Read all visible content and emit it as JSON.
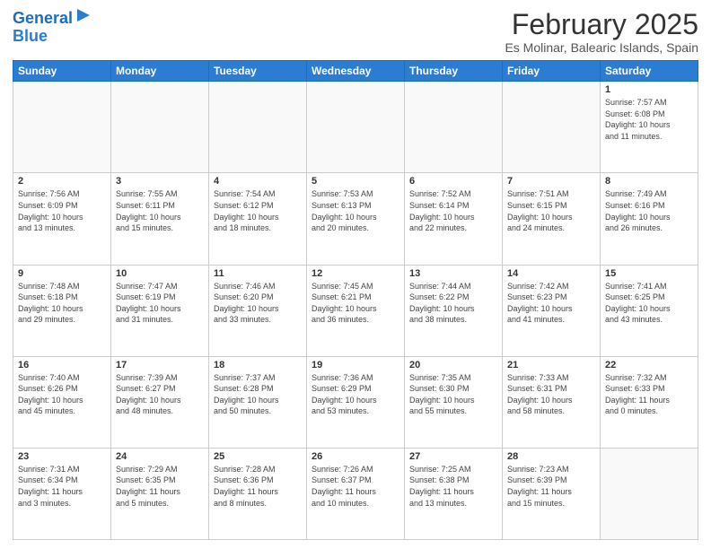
{
  "logo": {
    "line1": "General",
    "line2": "Blue"
  },
  "header": {
    "month": "February 2025",
    "location": "Es Molinar, Balearic Islands, Spain"
  },
  "weekdays": [
    "Sunday",
    "Monday",
    "Tuesday",
    "Wednesday",
    "Thursday",
    "Friday",
    "Saturday"
  ],
  "weeks": [
    [
      {
        "day": "",
        "info": ""
      },
      {
        "day": "",
        "info": ""
      },
      {
        "day": "",
        "info": ""
      },
      {
        "day": "",
        "info": ""
      },
      {
        "day": "",
        "info": ""
      },
      {
        "day": "",
        "info": ""
      },
      {
        "day": "1",
        "info": "Sunrise: 7:57 AM\nSunset: 6:08 PM\nDaylight: 10 hours\nand 11 minutes."
      }
    ],
    [
      {
        "day": "2",
        "info": "Sunrise: 7:56 AM\nSunset: 6:09 PM\nDaylight: 10 hours\nand 13 minutes."
      },
      {
        "day": "3",
        "info": "Sunrise: 7:55 AM\nSunset: 6:11 PM\nDaylight: 10 hours\nand 15 minutes."
      },
      {
        "day": "4",
        "info": "Sunrise: 7:54 AM\nSunset: 6:12 PM\nDaylight: 10 hours\nand 18 minutes."
      },
      {
        "day": "5",
        "info": "Sunrise: 7:53 AM\nSunset: 6:13 PM\nDaylight: 10 hours\nand 20 minutes."
      },
      {
        "day": "6",
        "info": "Sunrise: 7:52 AM\nSunset: 6:14 PM\nDaylight: 10 hours\nand 22 minutes."
      },
      {
        "day": "7",
        "info": "Sunrise: 7:51 AM\nSunset: 6:15 PM\nDaylight: 10 hours\nand 24 minutes."
      },
      {
        "day": "8",
        "info": "Sunrise: 7:49 AM\nSunset: 6:16 PM\nDaylight: 10 hours\nand 26 minutes."
      }
    ],
    [
      {
        "day": "9",
        "info": "Sunrise: 7:48 AM\nSunset: 6:18 PM\nDaylight: 10 hours\nand 29 minutes."
      },
      {
        "day": "10",
        "info": "Sunrise: 7:47 AM\nSunset: 6:19 PM\nDaylight: 10 hours\nand 31 minutes."
      },
      {
        "day": "11",
        "info": "Sunrise: 7:46 AM\nSunset: 6:20 PM\nDaylight: 10 hours\nand 33 minutes."
      },
      {
        "day": "12",
        "info": "Sunrise: 7:45 AM\nSunset: 6:21 PM\nDaylight: 10 hours\nand 36 minutes."
      },
      {
        "day": "13",
        "info": "Sunrise: 7:44 AM\nSunset: 6:22 PM\nDaylight: 10 hours\nand 38 minutes."
      },
      {
        "day": "14",
        "info": "Sunrise: 7:42 AM\nSunset: 6:23 PM\nDaylight: 10 hours\nand 41 minutes."
      },
      {
        "day": "15",
        "info": "Sunrise: 7:41 AM\nSunset: 6:25 PM\nDaylight: 10 hours\nand 43 minutes."
      }
    ],
    [
      {
        "day": "16",
        "info": "Sunrise: 7:40 AM\nSunset: 6:26 PM\nDaylight: 10 hours\nand 45 minutes."
      },
      {
        "day": "17",
        "info": "Sunrise: 7:39 AM\nSunset: 6:27 PM\nDaylight: 10 hours\nand 48 minutes."
      },
      {
        "day": "18",
        "info": "Sunrise: 7:37 AM\nSunset: 6:28 PM\nDaylight: 10 hours\nand 50 minutes."
      },
      {
        "day": "19",
        "info": "Sunrise: 7:36 AM\nSunset: 6:29 PM\nDaylight: 10 hours\nand 53 minutes."
      },
      {
        "day": "20",
        "info": "Sunrise: 7:35 AM\nSunset: 6:30 PM\nDaylight: 10 hours\nand 55 minutes."
      },
      {
        "day": "21",
        "info": "Sunrise: 7:33 AM\nSunset: 6:31 PM\nDaylight: 10 hours\nand 58 minutes."
      },
      {
        "day": "22",
        "info": "Sunrise: 7:32 AM\nSunset: 6:33 PM\nDaylight: 11 hours\nand 0 minutes."
      }
    ],
    [
      {
        "day": "23",
        "info": "Sunrise: 7:31 AM\nSunset: 6:34 PM\nDaylight: 11 hours\nand 3 minutes."
      },
      {
        "day": "24",
        "info": "Sunrise: 7:29 AM\nSunset: 6:35 PM\nDaylight: 11 hours\nand 5 minutes."
      },
      {
        "day": "25",
        "info": "Sunrise: 7:28 AM\nSunset: 6:36 PM\nDaylight: 11 hours\nand 8 minutes."
      },
      {
        "day": "26",
        "info": "Sunrise: 7:26 AM\nSunset: 6:37 PM\nDaylight: 11 hours\nand 10 minutes."
      },
      {
        "day": "27",
        "info": "Sunrise: 7:25 AM\nSunset: 6:38 PM\nDaylight: 11 hours\nand 13 minutes."
      },
      {
        "day": "28",
        "info": "Sunrise: 7:23 AM\nSunset: 6:39 PM\nDaylight: 11 hours\nand 15 minutes."
      },
      {
        "day": "",
        "info": ""
      }
    ]
  ]
}
